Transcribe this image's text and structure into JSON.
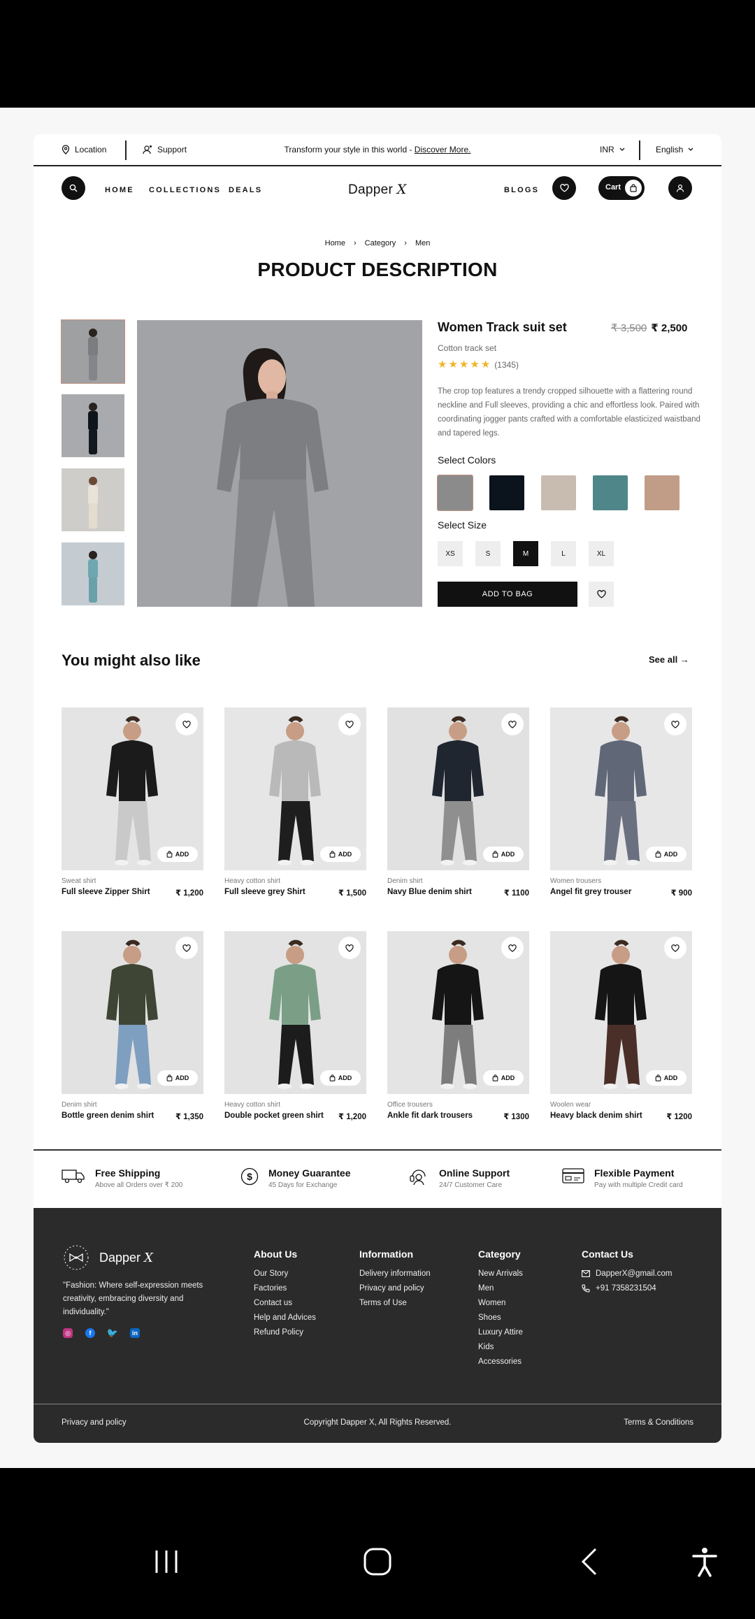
{
  "topbar": {
    "location": "Location",
    "support": "Support",
    "promo_text": "Transform your style in this world - ",
    "promo_link": "Discover More.",
    "currency": "INR",
    "language": "English"
  },
  "nav": {
    "links": [
      "HOME",
      "COLLECTIONS",
      "DEALS"
    ],
    "logo_text": "Dapper",
    "logo_mark": "X",
    "blogs": "BLOGS",
    "cart": "Cart"
  },
  "breadcrumb": [
    "Home",
    "Category",
    "Men"
  ],
  "page_title": "PRODUCT DESCRIPTION",
  "product": {
    "name": "Women Track suit set",
    "old_price": "₹ 3,500",
    "price": "₹ 2,500",
    "subtitle": "Cotton track set",
    "rating": 5,
    "reviews": "(1345)",
    "description": "The crop top features a trendy cropped silhouette with a flattering round neckline and Full sleeves, providing a chic and effortless look. Paired with coordinating jogger pants crafted with a comfortable elasticized waistband and tapered legs.",
    "colors_label": "Select Colors",
    "colors": [
      "#8b8b8b",
      "#0b131c",
      "#c8bcb0",
      "#4f8689",
      "#c19d87"
    ],
    "size_label": "Select Size",
    "sizes": [
      "XS",
      "S",
      "M",
      "L",
      "XL"
    ],
    "selected_size": "M",
    "add_to_bag": "ADD TO BAG"
  },
  "related": {
    "title": "You might also like",
    "see_all": "See all →",
    "add_label": "ADD",
    "items": [
      {
        "category": "Sweat shirt",
        "name": "Full sleeve Zipper Shirt",
        "price": "₹ 1,200",
        "top": "#1b1b1b",
        "bottom": "#c9c9c9",
        "bg": "#e4e4e4"
      },
      {
        "category": "Heavy cotton shirt",
        "name": "Full sleeve grey Shirt",
        "price": "₹ 1,500",
        "top": "#b9b9b9",
        "bottom": "#1e1e1e",
        "bg": "#e6e6e6"
      },
      {
        "category": "Denim shirt",
        "name": "Navy Blue denim shirt",
        "price": "₹ 1100",
        "top": "#1f2630",
        "bottom": "#8f8f8f",
        "bg": "#e1e1e1"
      },
      {
        "category": "Women trousers",
        "name": "Angel fit grey trouser",
        "price": "₹ 900",
        "top": "#606878",
        "bottom": "#6b7080",
        "bg": "#e7e7e7"
      },
      {
        "category": "Denim shirt",
        "name": "Bottle green denim shirt",
        "price": "₹ 1,350",
        "top": "#3f4534",
        "bottom": "#7f9fc0",
        "bg": "#e2e2e2"
      },
      {
        "category": "Heavy cotton shirt",
        "name": "Double pocket green shirt",
        "price": "₹ 1,200",
        "top": "#7a9f86",
        "bottom": "#1c1c1c",
        "bg": "#e3e3e3"
      },
      {
        "category": "Office trousers",
        "name": "Ankle fit dark trousers",
        "price": "₹ 1300",
        "top": "#151515",
        "bottom": "#7d7d7d",
        "bg": "#e4e4e4"
      },
      {
        "category": "Woolen wear",
        "name": "Heavy black denim shirt",
        "price": "₹ 1200",
        "top": "#151515",
        "bottom": "#4a2f28",
        "bg": "#e6e6e6"
      }
    ]
  },
  "features": [
    {
      "title": "Free Shipping",
      "sub": "Above all Orders over ₹ 200",
      "icon": "truck-icon"
    },
    {
      "title": "Money Guarantee",
      "sub": "45 Days for Exchange",
      "icon": "dollar-icon"
    },
    {
      "title": "Online Support",
      "sub": "24/7 Customer Care",
      "icon": "headset-icon"
    },
    {
      "title": "Flexible Payment",
      "sub": "Pay with multiple Credit card",
      "icon": "card-icon"
    }
  ],
  "footer": {
    "brand": "Dapper",
    "brand_mark": "X",
    "tagline": "\"Fashion: Where self-expression meets creativity, embracing diversity and individuality.\"",
    "about": {
      "title": "About Us",
      "items": [
        "Our Story",
        "Factories",
        "Contact us",
        "Help and Advices",
        "Refund Policy"
      ]
    },
    "info": {
      "title": "Information",
      "items": [
        "Delivery information",
        "Privacy and policy",
        "Terms of Use"
      ]
    },
    "category": {
      "title": "Category",
      "items": [
        "New Arrivals",
        "Men",
        "Women",
        "Shoes",
        "Luxury Attire",
        "Kids",
        "Accessories"
      ]
    },
    "contact": {
      "title": "Contact Us",
      "email": "DapperX@gmail.com",
      "phone": "+91 7358231504"
    },
    "privacy": "Privacy and policy",
    "copyright": "Copyright Dapper X, All Rights Reserved.",
    "terms": "Terms & Conditions"
  }
}
